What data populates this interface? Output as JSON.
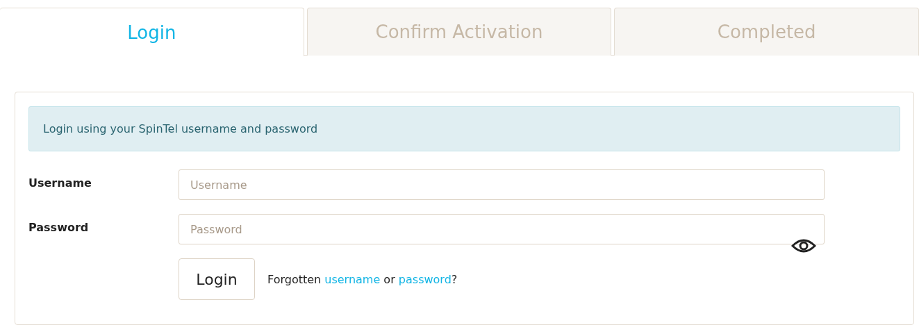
{
  "tabs": [
    {
      "label": "Login",
      "selected": true
    },
    {
      "label": "Confirm Activation",
      "selected": false
    },
    {
      "label": "Completed",
      "selected": false
    }
  ],
  "notice": "Login using your SpinTel username and password",
  "fields": [
    {
      "label": "Username",
      "placeholder": "Username",
      "kind": "text"
    },
    {
      "label": "Password",
      "placeholder": "Password",
      "kind": "password"
    }
  ],
  "login_button": "Login",
  "forgotten": [
    {
      "text": "Forgotten ",
      "kind": "text"
    },
    {
      "text": "username",
      "kind": "link"
    },
    {
      "text": " or ",
      "kind": "text"
    },
    {
      "text": "password",
      "kind": "link"
    },
    {
      "text": "?",
      "kind": "text"
    }
  ]
}
